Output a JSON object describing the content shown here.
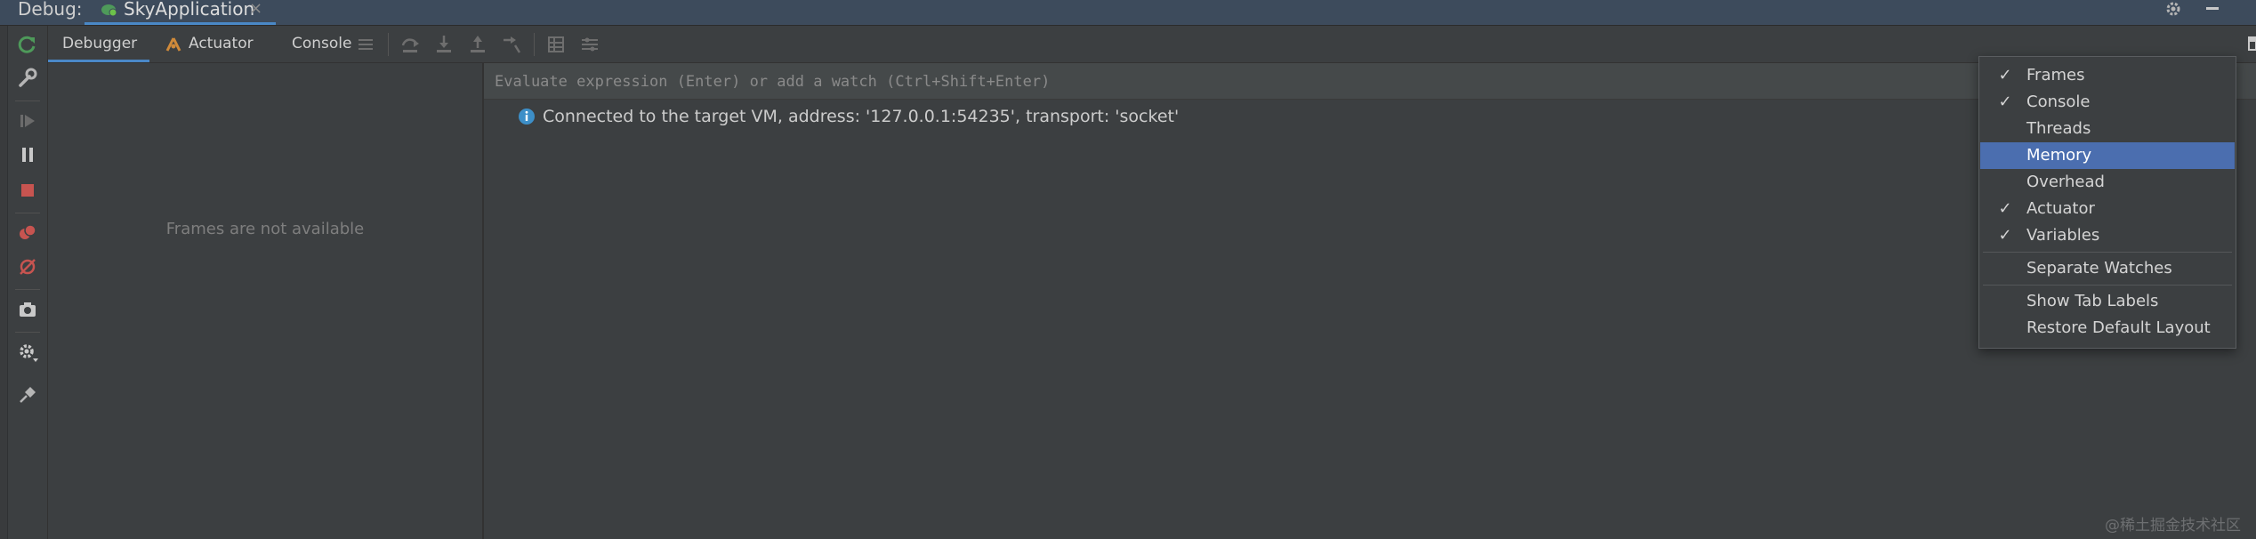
{
  "titlebar": {
    "debug_label": "Debug:",
    "run_config": "SkyApplication",
    "close_glyph": "×"
  },
  "tabs": {
    "debugger": "Debugger",
    "actuator": "Actuator",
    "console": "Console"
  },
  "frames_panel": {
    "empty_message": "Frames are not available"
  },
  "evaluate": {
    "placeholder": "Evaluate expression (Enter) or add a watch (Ctrl+Shift+Enter)"
  },
  "console": {
    "message": "Connected to the target VM, address: '127.0.0.1:54235', transport: 'socket'"
  },
  "layout_menu": {
    "items": [
      {
        "label": "Frames",
        "checked": true
      },
      {
        "label": "Console",
        "checked": true
      },
      {
        "label": "Threads",
        "checked": false
      },
      {
        "label": "Memory",
        "checked": false,
        "highlighted": true
      },
      {
        "label": "Overhead",
        "checked": false
      },
      {
        "label": "Actuator",
        "checked": true
      },
      {
        "label": "Variables",
        "checked": true
      }
    ],
    "extra": [
      "Separate Watches",
      "Show Tab Labels",
      "Restore Default Layout"
    ],
    "check_glyph": "✓"
  },
  "watermark": "@稀土掘金技术社区",
  "colors": {
    "accent": "#4a88c7",
    "menu_selection": "#4b6eaf",
    "rerun_green": "#4e9a5a",
    "stop_red": "#c75450",
    "info_blue": "#3d8fc8"
  },
  "icons": {
    "left_toolbar": [
      "rerun-icon",
      "settings-wrench-icon",
      "resume-icon",
      "pause-icon",
      "stop-icon",
      "view-breakpoints-icon",
      "mute-breakpoints-icon",
      "camera-icon",
      "settings-gear-icon",
      "pin-icon"
    ],
    "tab_toolbar": [
      "hamburger-icon",
      "step-over-icon",
      "step-into-icon",
      "step-out-icon",
      "run-to-cursor-icon",
      "evaluate-table-icon",
      "trace-icon"
    ]
  }
}
